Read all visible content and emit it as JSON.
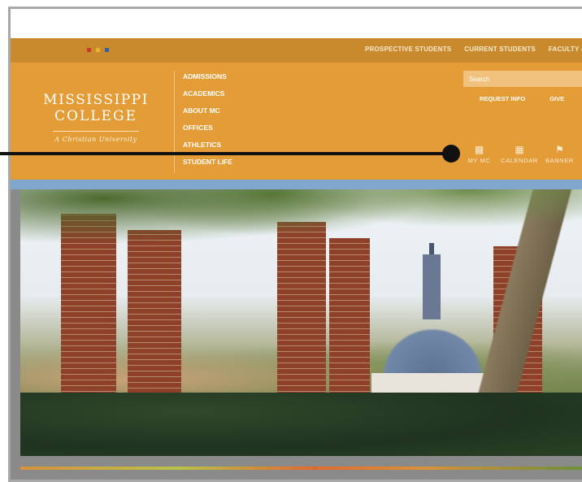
{
  "colors": {
    "topbar": "#c88a2c",
    "header": "#e49c36",
    "accent_dots": [
      "#c8392c",
      "#e7b22c",
      "#3a5fa8"
    ]
  },
  "top_nav": {
    "links": [
      "PROSPECTIVE STUDENTS",
      "CURRENT STUDENTS",
      "FACULTY &"
    ]
  },
  "logo": {
    "line1": "MISSISSIPPI",
    "line2": "COLLEGE",
    "tagline": "A Christian University"
  },
  "main_nav": {
    "items": [
      "ADMISSIONS",
      "ACADEMICS",
      "ABOUT MC",
      "OFFICES",
      "ATHLETICS",
      "STUDENT LIFE"
    ]
  },
  "search": {
    "placeholder": "Search"
  },
  "sub_links": [
    "REQUEST INFO",
    "GIVE"
  ],
  "quick_links": [
    {
      "icon": "user-icon",
      "label": "MY MC"
    },
    {
      "icon": "calendar-icon",
      "label": "CALENDAR"
    },
    {
      "icon": "flag-icon",
      "label": "BANNER"
    }
  ]
}
